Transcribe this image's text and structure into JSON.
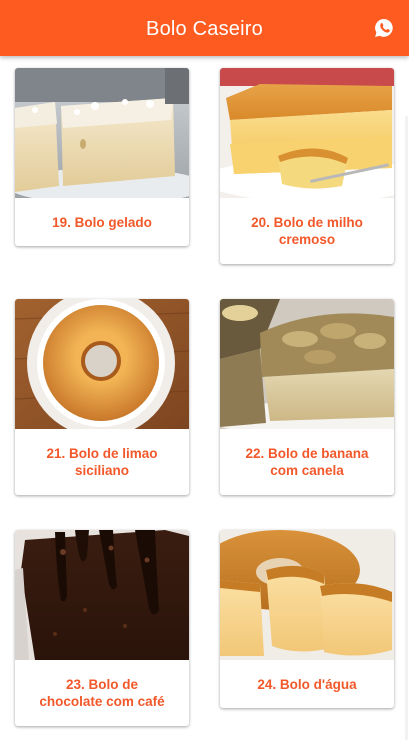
{
  "app": {
    "title": "Bolo Caseiro",
    "accent_color": "#fd5b1f",
    "label_color": "#f2582a",
    "share_icon": "whatsapp-icon"
  },
  "recipes": [
    {
      "label": "19. Bolo gelado",
      "image": "coconut-cake-photo"
    },
    {
      "label": "20. Bolo de milho\ncremoso",
      "image": "corn-cake-photo"
    },
    {
      "label": "21. Bolo de limao\nsiciliano",
      "image": "lemon-bundt-cake-photo"
    },
    {
      "label": "22. Bolo de banana\ncom canela",
      "image": "banana-cake-photo"
    },
    {
      "label": "23. Bolo de\nchocolate com café",
      "image": "chocolate-cake-photo"
    },
    {
      "label": "24. Bolo d'água",
      "image": "water-cake-photo"
    }
  ]
}
